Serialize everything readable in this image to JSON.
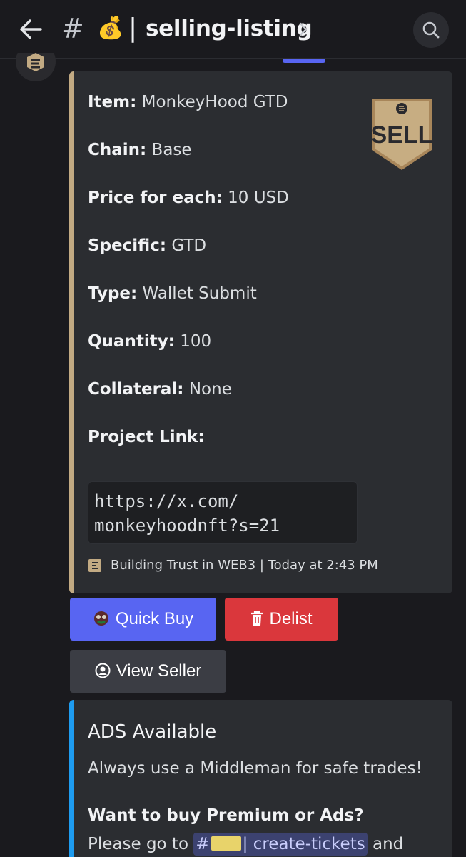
{
  "header": {
    "channel_prefix_emoji": "💰",
    "channel_name": "selling-listing",
    "icons": [
      "back-arrow-icon",
      "hash-icon",
      "chevron-right-icon",
      "search-icon"
    ]
  },
  "embed": {
    "accent_color": "#c2aa83",
    "fields": [
      {
        "label": "Item:",
        "value": "MonkeyHood GTD"
      },
      {
        "label": "Chain:",
        "value": "Base"
      },
      {
        "label": "Price for each:",
        "value": "10 USD"
      },
      {
        "label": "Specific:",
        "value": "GTD"
      },
      {
        "label": "Type:",
        "value": "Wallet Submit"
      },
      {
        "label": "Quantity:",
        "value": "100"
      },
      {
        "label": "Collateral:",
        "value": "None"
      },
      {
        "label": "Project Link:",
        "value": ""
      }
    ],
    "thumbnail_text": "SELL",
    "link_line1": "https://x.com/",
    "link_line2": "monkeyhoodnft?s=21",
    "footer": "Building Trust in WEB3 | Today at 2:43 PM"
  },
  "buttons": {
    "quick_buy": "Quick Buy",
    "delist": "Delist",
    "view_seller": "View Seller"
  },
  "ads": {
    "accent_color": "#1e9cf0",
    "title": "ADS Available",
    "description": "Always use a Middleman for safe trades!",
    "question": "Want to buy Premium or Ads?",
    "line_prefix": "Please go to",
    "channel_mention": "create-tickets",
    "line_suffix": "and"
  }
}
